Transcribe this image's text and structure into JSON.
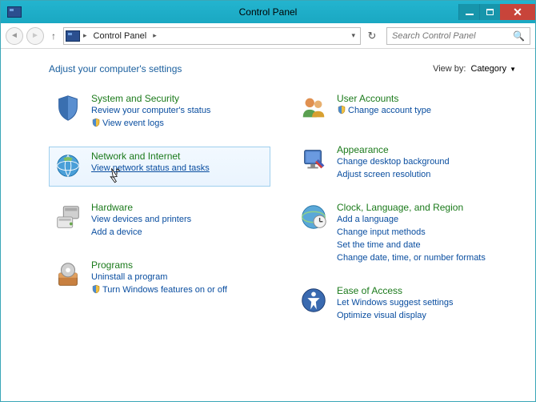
{
  "window": {
    "title": "Control Panel"
  },
  "nav": {
    "crumb": "Control Panel",
    "search_placeholder": "Search Control Panel"
  },
  "header": {
    "heading": "Adjust your computer's settings",
    "viewby_label": "View by:",
    "viewby_value": "Category"
  },
  "left": [
    {
      "id": "system-security",
      "title": "System and Security",
      "links": [
        {
          "text": "Review your computer's status",
          "shield": false
        },
        {
          "text": "View event logs",
          "shield": true
        }
      ]
    },
    {
      "id": "network-internet",
      "title": "Network and Internet",
      "selected": true,
      "links": [
        {
          "text": "View network status and tasks",
          "shield": false,
          "hovered": true
        }
      ]
    },
    {
      "id": "hardware",
      "title": "Hardware",
      "links": [
        {
          "text": "View devices and printers",
          "shield": false
        },
        {
          "text": "Add a device",
          "shield": false
        }
      ]
    },
    {
      "id": "programs",
      "title": "Programs",
      "links": [
        {
          "text": "Uninstall a program",
          "shield": false
        },
        {
          "text": "Turn Windows features on or off",
          "shield": true
        }
      ]
    }
  ],
  "right": [
    {
      "id": "user-accounts",
      "title": "User Accounts",
      "links": [
        {
          "text": "Change account type",
          "shield": true
        }
      ]
    },
    {
      "id": "appearance",
      "title": "Appearance",
      "links": [
        {
          "text": "Change desktop background",
          "shield": false
        },
        {
          "text": "Adjust screen resolution",
          "shield": false
        }
      ]
    },
    {
      "id": "clock-language-region",
      "title": "Clock, Language, and Region",
      "links": [
        {
          "text": "Add a language",
          "shield": false
        },
        {
          "text": "Change input methods",
          "shield": false
        },
        {
          "text": "Set the time and date",
          "shield": false
        },
        {
          "text": "Change date, time, or number formats",
          "shield": false
        }
      ]
    },
    {
      "id": "ease-of-access",
      "title": "Ease of Access",
      "links": [
        {
          "text": "Let Windows suggest settings",
          "shield": false
        },
        {
          "text": "Optimize visual display",
          "shield": false
        }
      ]
    }
  ]
}
